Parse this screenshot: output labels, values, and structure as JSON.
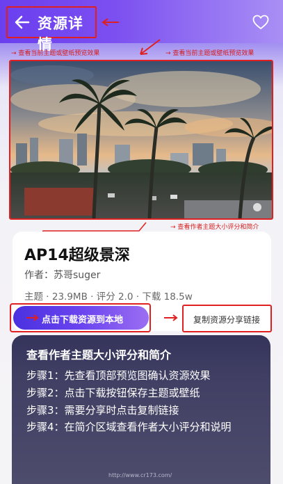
{
  "header": {
    "title": "资源详情",
    "back_icon": "arrow-left-icon",
    "favorite_icon": "heart-outline-icon"
  },
  "annotations": {
    "preview_note_left": "查看当前主题或壁纸预览效果",
    "preview_note_right": "查看当前主题或壁纸预览效果",
    "author_note": "查看作者主题大小评分和简介"
  },
  "resource": {
    "name": "AP14超级景深",
    "author_prefix": "作者：",
    "author": "苏哥suger",
    "stats": "主题 · 23.9MB · 评分 2.0 · 下载 18.5w"
  },
  "actions": {
    "download_label": "点击下载资源到本地",
    "share_label": "复制资源分享链接"
  },
  "guide": {
    "title": "查看作者主题大小评分和简介",
    "steps": [
      "步骤1：先查看顶部预览图确认资源效果",
      "步骤2：点击下载按钮保存主题或壁纸",
      "步骤3：需要分享时点击复制链接",
      "步骤4：在简介区域查看作者大小评分和说明"
    ]
  },
  "watermark": "http://www.cr173.com/",
  "colors": {
    "accent": "#6a3fef",
    "annotation_red": "#e02020"
  }
}
